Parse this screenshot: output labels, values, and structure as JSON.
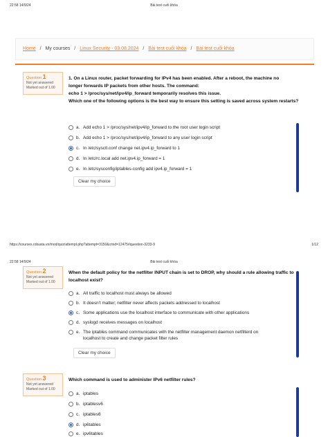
{
  "page1": {
    "header": {
      "left": "22:58 14/9/24",
      "center": "Bài test cuối khóa"
    },
    "footer": {
      "left": "https://courses.robusta.vn/mod/quiz/attempt.php?attempt=3150&cmid=12475#question-3233-9",
      "right": "1/12"
    }
  },
  "page2": {
    "header": {
      "left": "22:58 14/9/24",
      "center": "Bài test cuối khóa"
    }
  },
  "breadcrumb": {
    "home": "Home",
    "courses": "My courses",
    "course": "Linux Security - 03.08.2024",
    "section": "Bài test cuối khóa",
    "current": "Bài test cuối khóa"
  },
  "questions": [
    {
      "label": "Question",
      "number": "1",
      "status": "Not yet answered",
      "mark": "Marked out of 1.00",
      "text_lines": [
        "1.     On a Linux router, packet forwarding for IPv4 has been enabled. After a reboot, the machine no",
        "longer forwards IP packets from other hosts. The command:",
        "echo 1 > /proc/sys/net/ipv4/ip_forward temporarily resolves this issue.",
        "Which one of the following options is the best way to ensure this setting is saved across system restarts?"
      ],
      "answers": [
        {
          "letter": "a.",
          "text": "Add echo 1 > /proc/sys/net/ipv4/ip_forward to the root user login script",
          "selected": false
        },
        {
          "letter": "b.",
          "text": "Add echo 1 > /proc/sys/net/ipv4/ip_forward to any user login script",
          "selected": false
        },
        {
          "letter": "c.",
          "text": "In /etc/sysctl.conf change net.ipv4.ip_forward to 1",
          "selected": true
        },
        {
          "letter": "d.",
          "text": "In /etc/rc.local add net.ipv4.ip_forward = 1",
          "selected": false
        },
        {
          "letter": "e.",
          "text": "In /etc/sysconfig/iptables-config add ipv4.ip_forward = 1",
          "selected": false
        }
      ],
      "clear": "Clear my choice"
    },
    {
      "label": "Question",
      "number": "2",
      "status": "Not yet answered",
      "mark": "Marked out of 1.00",
      "text_lines": [
        "When the default policy for the netfilter INPUT chain is set to DROP, why should a rule allowing traffic to",
        "localhost exist?"
      ],
      "answers": [
        {
          "letter": "a.",
          "text": "All traffic to localhost must always be allowed",
          "selected": false
        },
        {
          "letter": "b.",
          "text": "It doesn't matter; netfilter never affects packets addressed to localhost",
          "selected": false
        },
        {
          "letter": "c.",
          "text": "Some applications use the localhost interface to communicate with other applications",
          "selected": true
        },
        {
          "letter": "d.",
          "text": "syslogd receives messages on localhost",
          "selected": false
        },
        {
          "letter": "e.",
          "text": "The iptables command communicates with the netfilter management daemon netfilterd on",
          "text2": "localhost to create and change packet filter rules",
          "selected": false
        }
      ],
      "clear": "Clear my choice"
    },
    {
      "label": "Question",
      "number": "3",
      "status": "Not yet answered",
      "mark": "Marked out of 1.00",
      "text_lines": [
        "Which command is used to administer IPv6 netfilter rules?"
      ],
      "answers": [
        {
          "letter": "a.",
          "text": "iptables",
          "selected": false
        },
        {
          "letter": "b.",
          "text": "iptablesv6",
          "selected": false
        },
        {
          "letter": "c.",
          "text": "iptables6",
          "selected": false
        },
        {
          "letter": "d.",
          "text": "ip6tables",
          "selected": true
        },
        {
          "letter": "e.",
          "text": "ipv6tables",
          "selected": false
        }
      ]
    }
  ],
  "colors": {
    "accent": "#f07c23",
    "selected": "#3b66d6",
    "scrollbar": "#1f3a93"
  }
}
